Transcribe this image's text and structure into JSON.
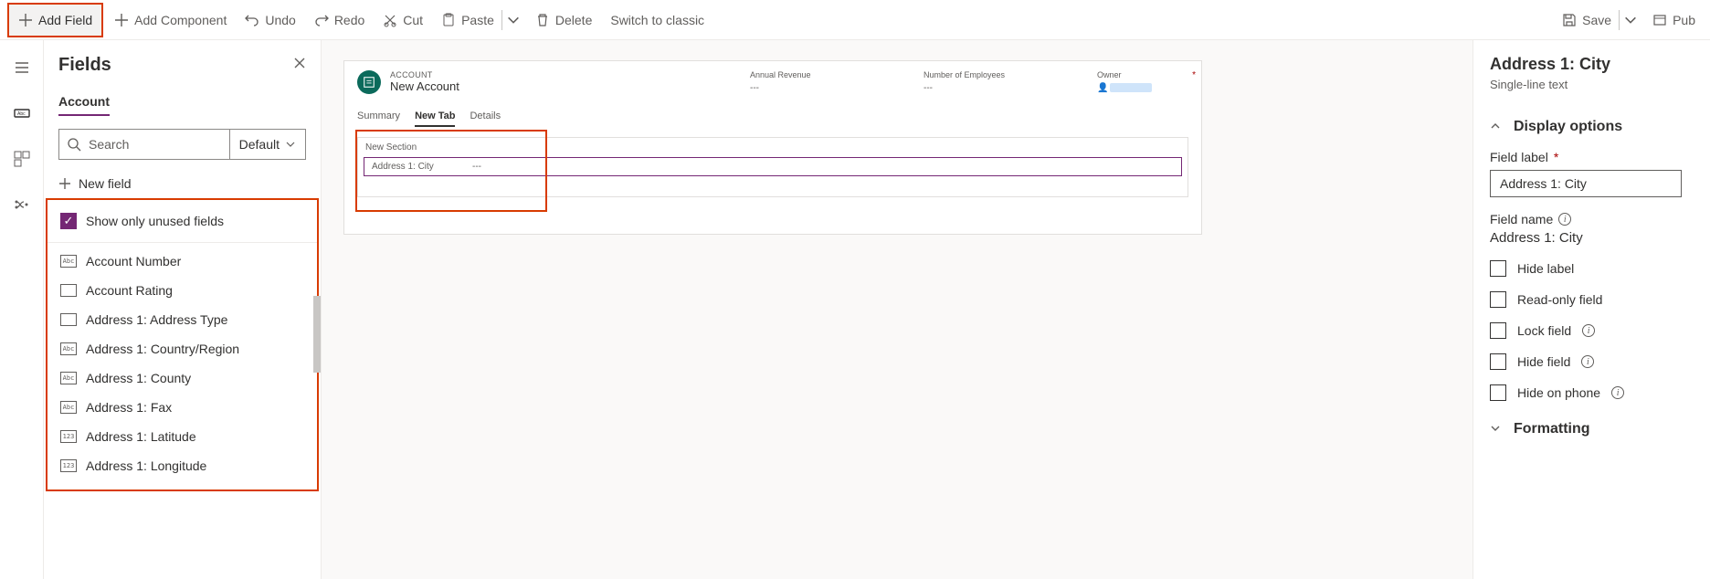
{
  "toolbar": {
    "add_field": "Add Field",
    "add_component": "Add Component",
    "undo": "Undo",
    "redo": "Redo",
    "cut": "Cut",
    "paste": "Paste",
    "delete": "Delete",
    "switch_classic": "Switch to classic",
    "save": "Save",
    "publish": "Pub"
  },
  "fields_panel": {
    "title": "Fields",
    "entity": "Account",
    "search_placeholder": "Search",
    "filter": "Default",
    "new_field": "New field",
    "show_unused": "Show only unused fields",
    "list": [
      {
        "type": "Abc",
        "label": "Account Number"
      },
      {
        "type": "",
        "label": "Account Rating"
      },
      {
        "type": "",
        "label": "Address 1: Address Type"
      },
      {
        "type": "Abc",
        "label": "Address 1: Country/Region"
      },
      {
        "type": "Abc",
        "label": "Address 1: County"
      },
      {
        "type": "Abc",
        "label": "Address 1: Fax"
      },
      {
        "type": "123",
        "label": "Address 1: Latitude"
      },
      {
        "type": "123",
        "label": "Address 1: Longitude"
      }
    ]
  },
  "form": {
    "entity_label": "ACCOUNT",
    "record_name": "New Account",
    "header_fields": [
      {
        "label": "Annual Revenue",
        "value": "---"
      },
      {
        "label": "Number of Employees",
        "value": "---"
      },
      {
        "label": "Owner",
        "value": "owner",
        "required": true
      }
    ],
    "tabs": [
      {
        "label": "Summary",
        "active": false
      },
      {
        "label": "New Tab",
        "active": true
      },
      {
        "label": "Details",
        "active": false
      }
    ],
    "section_name": "New Section",
    "selected_field": {
      "label": "Address 1: City",
      "value": "---"
    }
  },
  "properties": {
    "title": "Address 1: City",
    "subtitle": "Single-line text",
    "display_options": "Display options",
    "field_label_label": "Field label",
    "field_label_value": "Address 1: City",
    "field_name_label": "Field name",
    "field_name_value": "Address 1: City",
    "opts": {
      "hide_label": "Hide label",
      "read_only": "Read-only field",
      "lock_field": "Lock field",
      "hide_field": "Hide field",
      "hide_phone": "Hide on phone"
    },
    "formatting": "Formatting"
  }
}
